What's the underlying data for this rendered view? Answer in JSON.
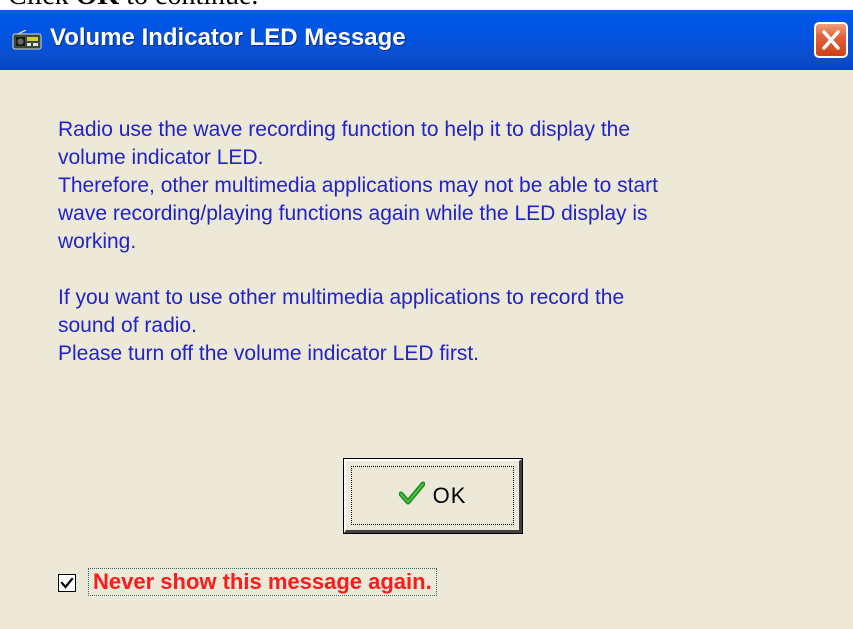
{
  "caption": {
    "text_prefix": "Click ",
    "text_bold": "OK",
    "text_suffix": " to continue."
  },
  "window": {
    "title": "Volume Indicator LED Message",
    "close_icon": "close-icon",
    "app_icon": "radio-icon"
  },
  "message": {
    "paragraph1_lines": [
      "Radio use the wave recording function to help it to display the",
      "volume indicator LED.",
      "Therefore, other multimedia applications may not be able to start",
      "wave recording/playing functions again while the LED display is",
      "working."
    ],
    "paragraph2_lines": [
      "If you want to use other multimedia applications to record the",
      "sound of radio.",
      "Please turn off the volume indicator LED first."
    ]
  },
  "ok_button": {
    "label": "OK",
    "icon": "checkmark-icon"
  },
  "checkbox": {
    "label": "Never show this message again.",
    "checked": true
  },
  "colors": {
    "titlebar": "#0054e3",
    "window_bg": "#ece9d8",
    "message_text": "#2222cc",
    "checkbox_label": "#ff1a1a"
  }
}
